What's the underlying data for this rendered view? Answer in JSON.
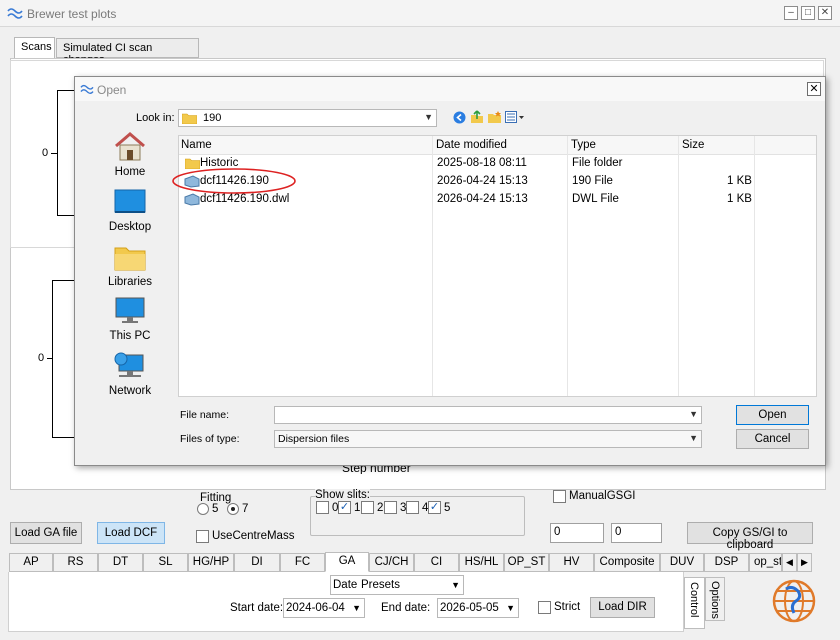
{
  "window": {
    "title": "Brewer test plots"
  },
  "top_tabs": [
    "Scans",
    "Simulated CI scan changes"
  ],
  "plots": {
    "y_tick_1": "0",
    "y_tick_2": "0",
    "x_label_partial": "Step number"
  },
  "dialog": {
    "title": "Open",
    "look_in_label": "Look in:",
    "look_in_value": "190",
    "places": [
      "Home",
      "Desktop",
      "Libraries",
      "This PC",
      "Network"
    ],
    "columns": [
      "Name",
      "Date modified",
      "Type",
      "Size"
    ],
    "files": [
      {
        "name": "Historic",
        "date": "2025-08-18 08:11",
        "type": "File folder",
        "size": ""
      },
      {
        "name": "dcf11426.190",
        "date": "2026-04-24 15:13",
        "type": "190 File",
        "size": "1 KB"
      },
      {
        "name": "dcf11426.190.dwl",
        "date": "2026-04-24 15:13",
        "type": "DWL File",
        "size": "1 KB"
      }
    ],
    "file_name_label": "File name:",
    "file_name_value": "",
    "file_type_label": "Files of type:",
    "file_type_value": "Dispersion files",
    "open_button": "Open",
    "cancel_button": "Cancel"
  },
  "controls": {
    "fitting_label": "Fitting",
    "fitting_options": [
      "5",
      "7"
    ],
    "fitting_selected": "7",
    "show_slits_label": "Show slits:",
    "slits": [
      {
        "label": "0",
        "checked": false
      },
      {
        "label": "1",
        "checked": true
      },
      {
        "label": "2",
        "checked": false
      },
      {
        "label": "3",
        "checked": false
      },
      {
        "label": "4",
        "checked": false
      },
      {
        "label": "5",
        "checked": true
      }
    ],
    "manual_gsgi_label": "ManualGSGI",
    "load_ga_button": "Load GA file",
    "load_dcf_button": "Load DCF",
    "use_centre_mass_label": "UseCentreMass",
    "gs_value": "0",
    "gi_value": "0",
    "copy_button": "Copy GS/GI to clipboard"
  },
  "bottom_tabs": [
    "AP",
    "RS",
    "DT",
    "SL",
    "HG/HP",
    "DI",
    "FC",
    "GA",
    "CJ/CH",
    "CI",
    "HS/HL",
    "OP_ST",
    "HV",
    "Composite",
    "DUV",
    "DSP",
    "op_st"
  ],
  "active_bottom_tab": "GA",
  "footer": {
    "date_label": "Date",
    "presets_value": "Presets",
    "start_date_label": "Start date:",
    "start_date_value": "2024-06-04",
    "end_date_label": "End date:",
    "end_date_value": "2026-05-05",
    "strict_label": "Strict",
    "load_dir_button": "Load DIR",
    "side_tabs": [
      "Control",
      "Options"
    ]
  }
}
